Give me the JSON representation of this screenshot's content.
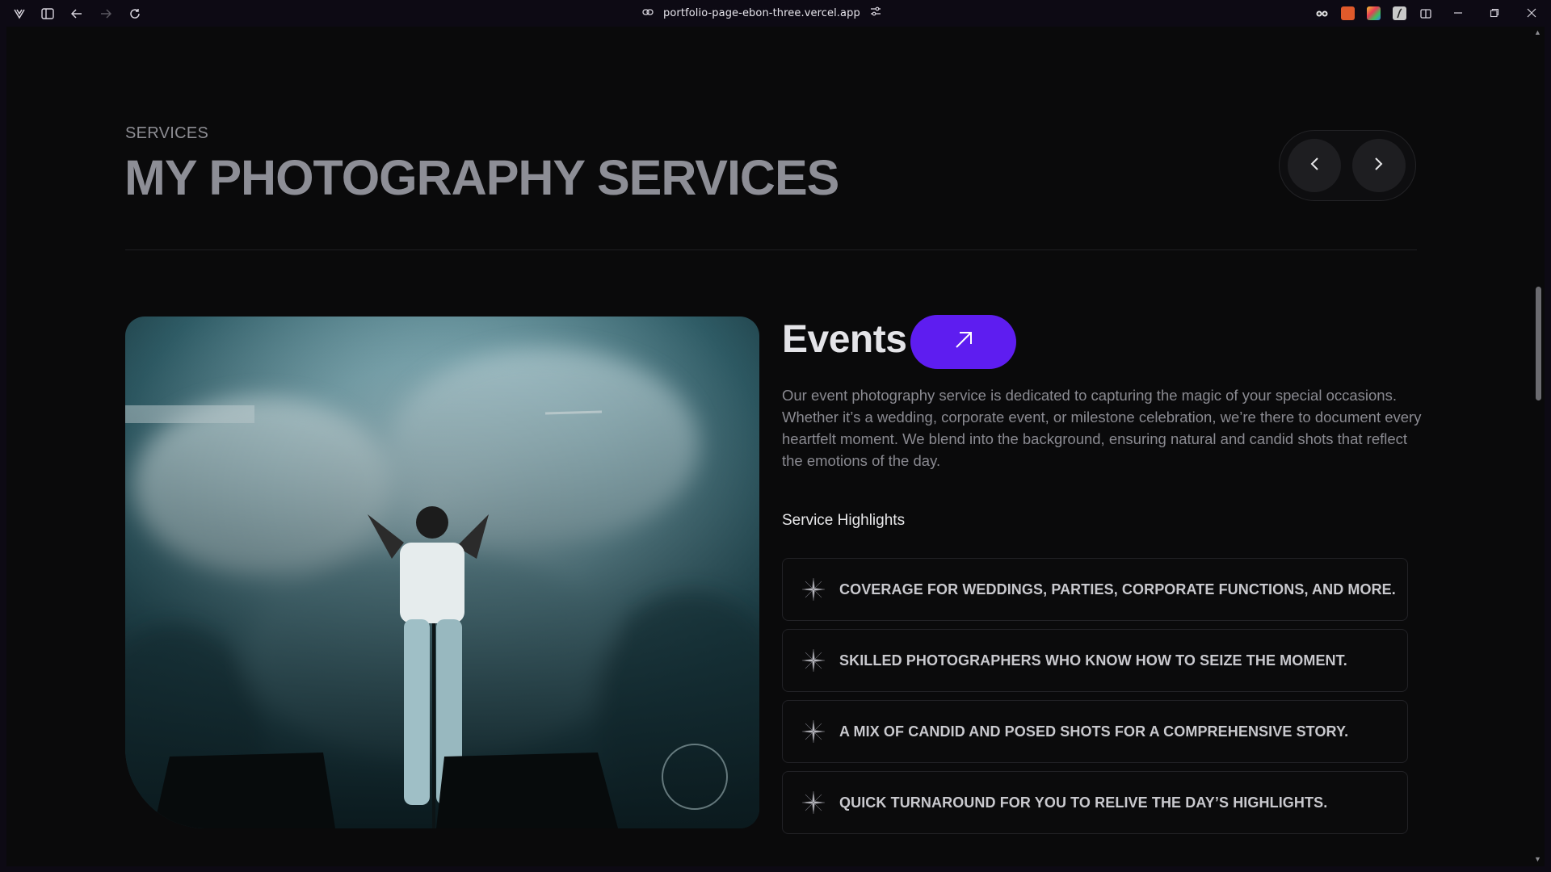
{
  "browser": {
    "url": "portfolio-page-ebon-three.vercel.app",
    "icons": [
      "vivaldi-logo-icon",
      "sidebar-toggle-icon",
      "back-icon",
      "forward-icon",
      "reload-icon",
      "link-icon",
      "tune-icon"
    ],
    "extension_colors": [
      "#e05a2b",
      "#3fbf5a",
      "#c9c9c9"
    ]
  },
  "header": {
    "eyebrow": "SERVICES",
    "title": "MY PHOTOGRAPHY SERVICES",
    "prev_icon": "chevron-left-icon",
    "next_icon": "chevron-right-icon"
  },
  "service": {
    "title": "Events",
    "button_icon": "arrow-up-right-icon",
    "button_color": "#5e1df0",
    "description": "Our event photography service is dedicated to capturing the magic of your special occasions. Whether it’s a wedding, corporate event, or milestone celebration, we’re there to document every heartfelt moment. We blend into the background, ensuring natural and candid shots that reflect the emotions of the day.",
    "highlights_title": "Service Highlights",
    "highlights": [
      "COVERAGE FOR WEDDINGS, PARTIES, CORPORATE FUNCTIONS, AND MORE.",
      "SKILLED PHOTOGRAPHERS WHO KNOW HOW TO SEIZE THE MOMENT.",
      "A MIX OF CANDID AND POSED SHOTS FOR A COMPREHENSIVE STORY.",
      "QUICK TURNAROUND FOR YOU TO RELIVE THE DAY’S HIGHLIGHTS."
    ],
    "image_subject": "performer on stage with smoke and microphone stand"
  }
}
